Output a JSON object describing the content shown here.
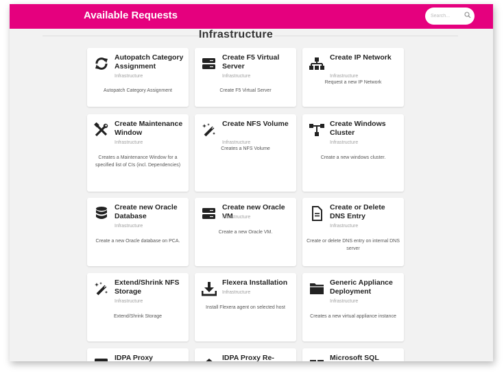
{
  "header": {
    "title": "Available Requests",
    "search_placeholder": "Search..."
  },
  "section": {
    "title": "Infrastructure"
  },
  "colors": {
    "accent": "#e5007e",
    "background": "#f2f2f2",
    "card": "#ffffff"
  },
  "cards": [
    {
      "title": "Autopatch Category Assignment",
      "category": "Infrastructure",
      "description": "Autopatch Category Assignment",
      "icon": "refresh-icon"
    },
    {
      "title": "Create F5 Virtual Server",
      "category": "Infrastructure",
      "description": "Create F5 Virtual Server",
      "icon": "server-icon"
    },
    {
      "title": "Create IP Network",
      "category": "Infrastructure",
      "description": "Request a new IP Network",
      "icon": "network-icon"
    },
    {
      "title": "Create Maintenance Window",
      "category": "Infrastructure",
      "description": "Creates a Maintenance Window for a specified list of CIs (incl. Dependencies)",
      "icon": "tools-icon"
    },
    {
      "title": "Create NFS Volume",
      "category": "Infrastructure",
      "description": "Creates a NFS Volume",
      "icon": "magic-wand-icon"
    },
    {
      "title": "Create Windows Cluster",
      "category": "Infrastructure",
      "description": "Create a new windows cluster.",
      "icon": "sitemap-icon"
    },
    {
      "title": "Create new Oracle Database",
      "category": "Infrastructure",
      "description": "Create a new Oracle database on PCA.",
      "icon": "database-icon"
    },
    {
      "title": "Create new Oracle VM",
      "category": "Infrastructure",
      "description": "Create a new Oracle VM.",
      "icon": "server-icon"
    },
    {
      "title": "Create or Delete DNS Entry",
      "category": "Infrastructure",
      "description": "Create or delete DNS entry on internal DNS server",
      "icon": "document-icon"
    },
    {
      "title": "Extend/Shrink NFS Storage",
      "category": "Infrastructure",
      "description": "Extend/Shrink Storage",
      "icon": "magic-wand-icon"
    },
    {
      "title": "Flexera Installation",
      "category": "Infrastructure",
      "description": "Install Flexera agent on selected host",
      "icon": "download-icon"
    },
    {
      "title": "Generic Appliance Deployment",
      "category": "Infrastructure",
      "description": "Creates a new virtual appliance instance",
      "icon": "folder-icon"
    },
    {
      "title": "IDPA Proxy",
      "category": "",
      "description": "",
      "icon": "server-icon"
    },
    {
      "title": "IDPA Proxy Re-",
      "category": "",
      "description": "",
      "icon": "network-icon"
    },
    {
      "title": "Microsoft SQL Server",
      "category": "",
      "description": "",
      "icon": "server-icon"
    }
  ]
}
